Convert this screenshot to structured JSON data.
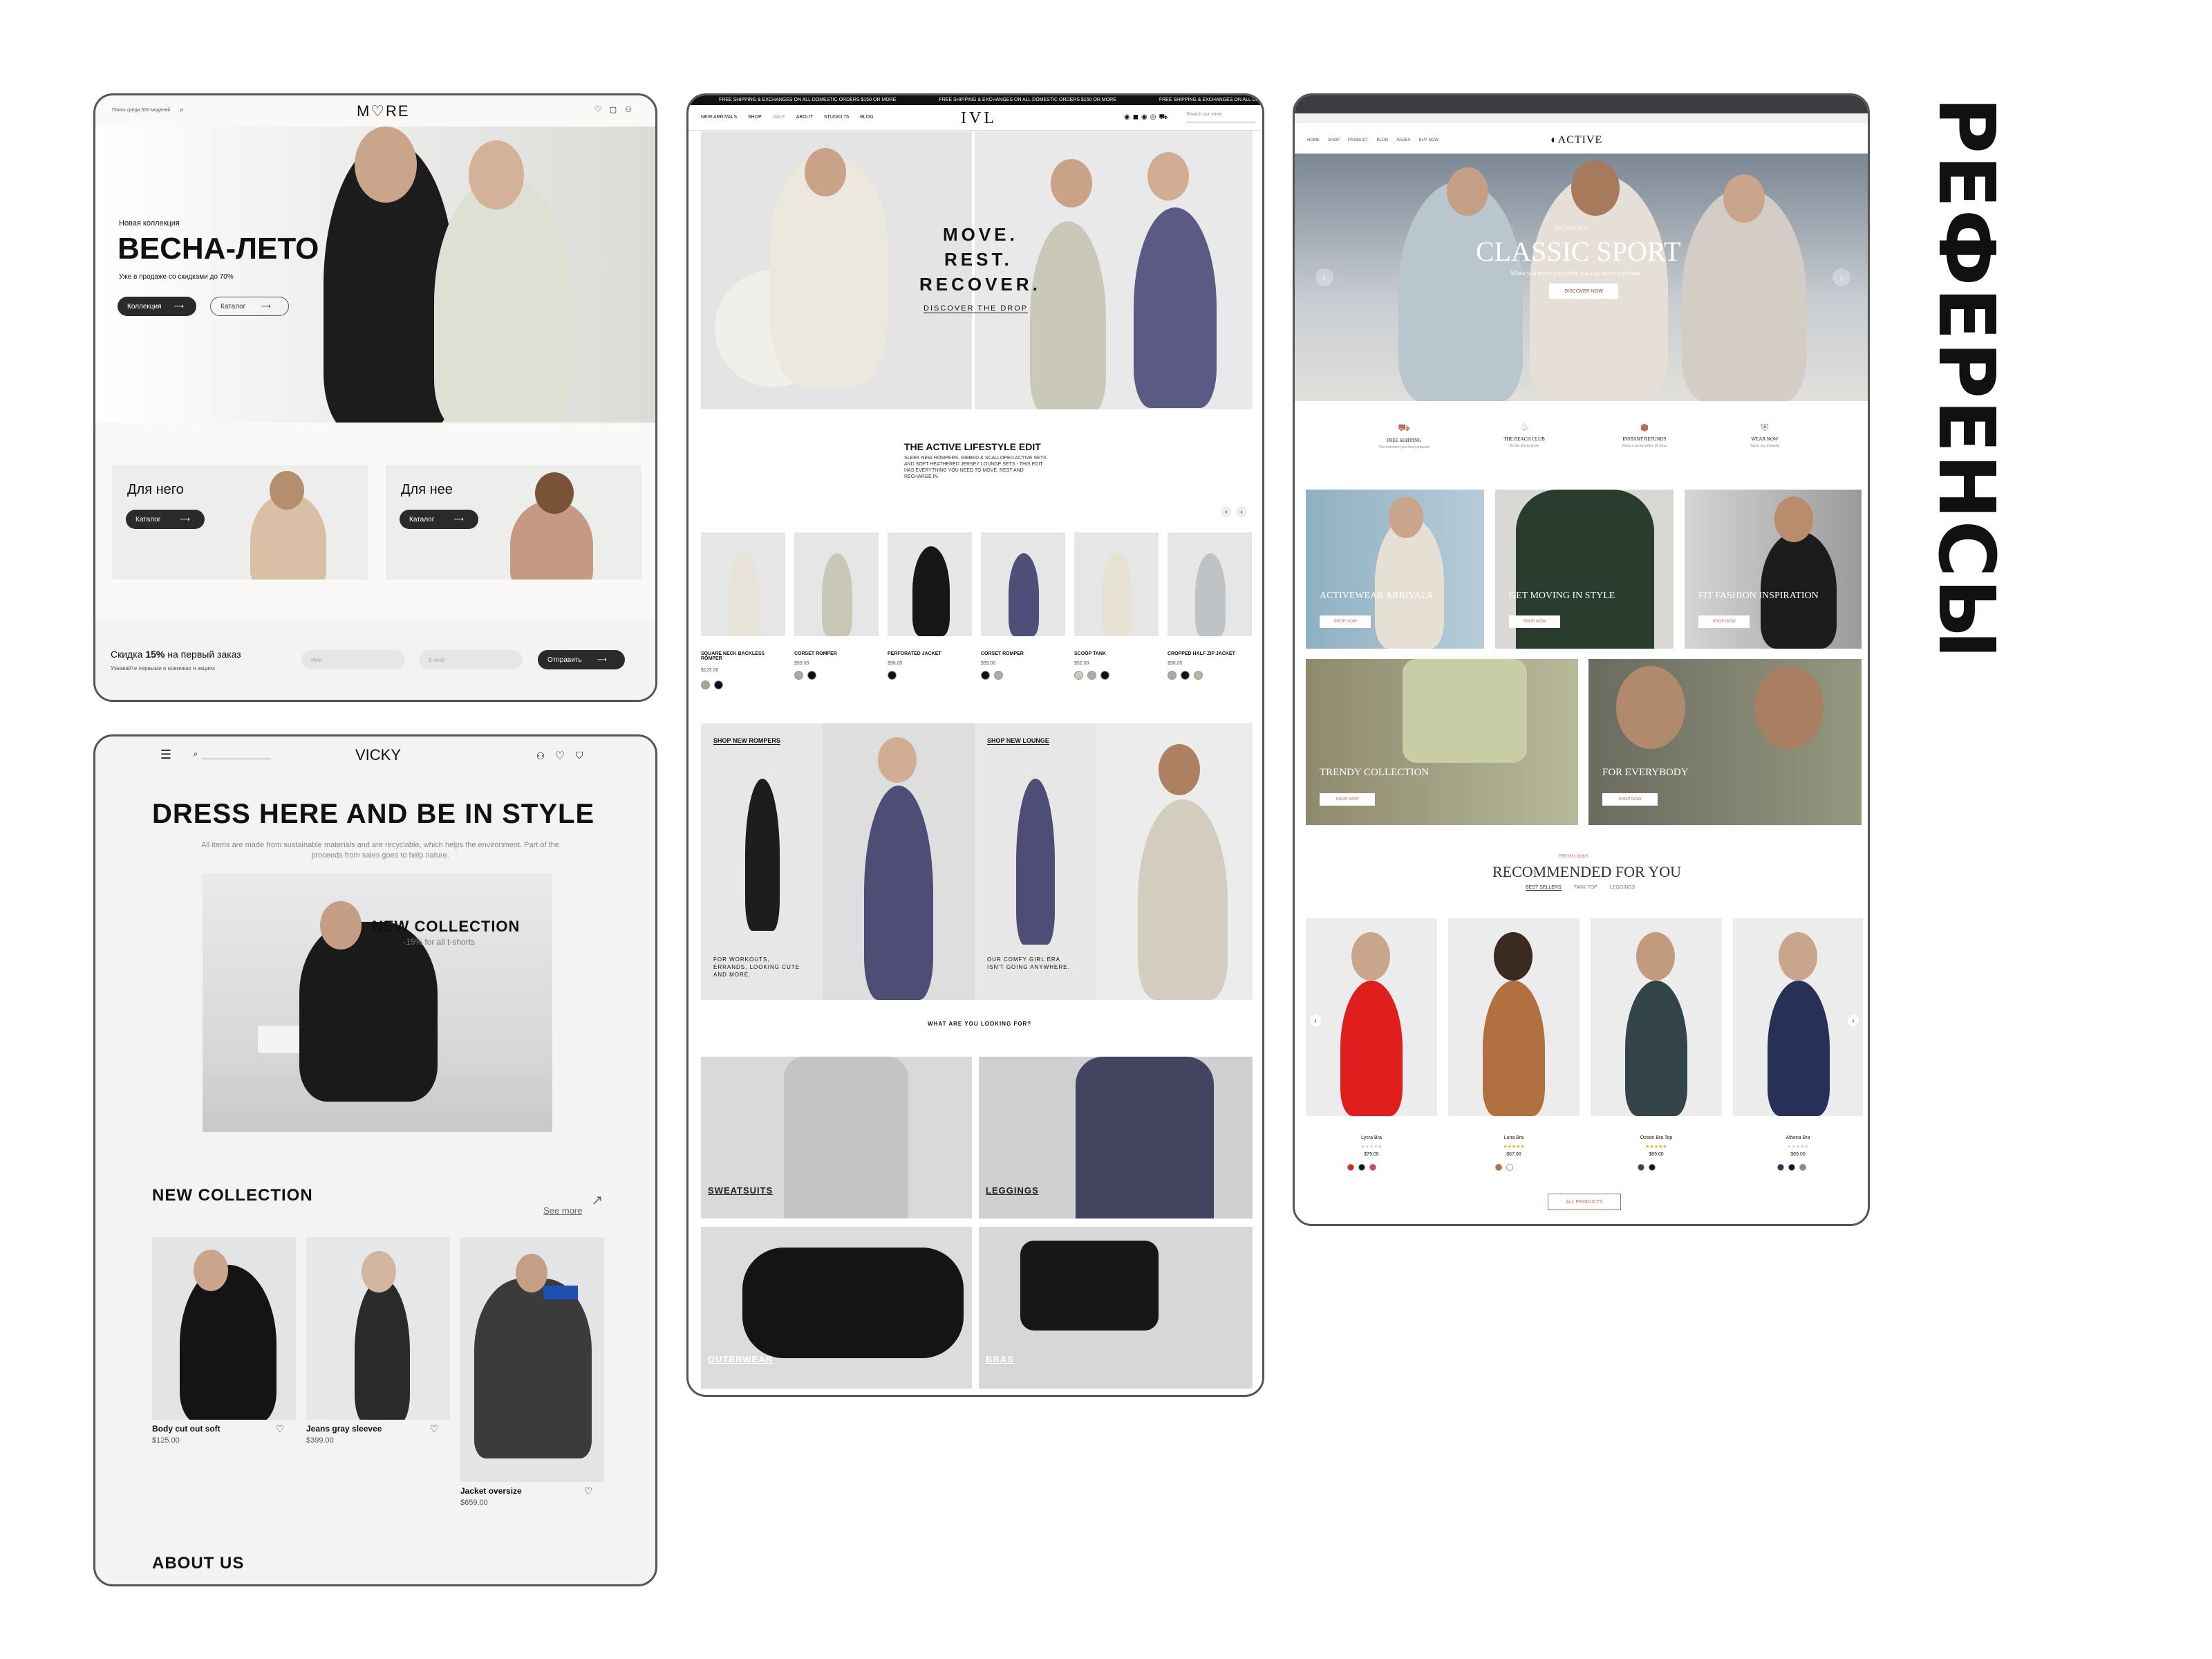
{
  "title_vertical": "РЕФЕРЕНСЫ",
  "more": {
    "search_hint": "Поиск среди 500 моделей",
    "logo": "M♡RE",
    "hero_kicker": "Новая коллекция",
    "hero_title": "ВЕСНА-ЛЕТО",
    "hero_sub": "Уже в продаже со скидками до 70%",
    "btn_collection": "Коллекция",
    "btn_catalog": "Каталог",
    "for_him": "Для него",
    "for_her": "Для нее",
    "catalog": "Каталог",
    "discount_prefix": "Скидка ",
    "discount_value": "15%",
    "discount_suffix": " на первый заказ",
    "discount_sub": "Узнавайте первыми о новинках и акциях",
    "name_placeholder": "Имя",
    "email_placeholder": "E-mail",
    "submit": "Отправить"
  },
  "vicky": {
    "logo": "VICKY",
    "headline": "DRESS HERE AND BE IN STYLE",
    "subtext": "All items are made from sustainable materials and are recyclable, which helps the environment. Part of the proceeds from sales goes to help nature.",
    "banner_title": "NEW COLLECTION",
    "banner_sub": "-15% for all t-shorts",
    "section_title": "NEW COLLECTION",
    "see_more": "See more",
    "products": [
      {
        "name": "Body cut out soft",
        "price": "$125.00"
      },
      {
        "name": "Jeans gray sleevee",
        "price": "$399.00"
      },
      {
        "name": "Jacket oversize",
        "price": "$659.00"
      }
    ],
    "about": "ABOUT US"
  },
  "ivl": {
    "banner": "FREE SHIPPING & EXCHANGES ON ALL DOMESTIC ORDERS $150 OR MORE",
    "nav": [
      "NEW ARRIVALS",
      "SHOP",
      "SALE",
      "ABOUT",
      "STUDIO 75",
      "BLOG"
    ],
    "logo": "IVL",
    "search_placeholder": "Search our store",
    "hero_line1": "MOVE.",
    "hero_line2": "REST.",
    "hero_line3": "RECOVER.",
    "hero_cta": "DISCOVER THE DROP",
    "edit_title": "THE ACTIVE LIFESTYLE EDIT",
    "edit_text": "SLEEK NEW ROMPERS, RIBBED & SCALLOPED ACTIVE SETS AND SOFT HEATHERED JERSEY LOUNGE SETS - THIS EDIT HAS EVERYTHING YOU NEED TO MOVE, REST AND RECHARGE IN.",
    "products": [
      {
        "name": "SQUARE NECK BACKLESS ROMPER",
        "price": "$123.00"
      },
      {
        "name": "CORSET ROMPER",
        "price": "$99.00"
      },
      {
        "name": "PERFORATED JACKET",
        "price": "$98.00"
      },
      {
        "name": "CORSET ROMPER",
        "price": "$99.00"
      },
      {
        "name": "SCOOP TANK",
        "price": "$52.00"
      },
      {
        "name": "CROPPED HALF ZIP JACKET",
        "price": "$98.00"
      }
    ],
    "shop_rompers": "SHOP NEW ROMPERS",
    "rompers_text": "FOR WORKOUTS, ERRANDS, LOOKING CUTE AND MORE.",
    "shop_lounge": "SHOP NEW LOUNGE",
    "lounge_text": "OUR COMFY GIRL ERA ISN'T GOING ANYWHERE.",
    "looking_for": "WHAT ARE YOU LOOKING FOR?",
    "categories": [
      "SWEATSUITS",
      "LEGGINGS",
      "OUTERWEAR",
      "BRAS"
    ]
  },
  "active": {
    "logo": "ACTIVE",
    "hero_kicker": "ALL NEW SS24",
    "hero_title": "CLASSIC SPORT",
    "hero_sub": "When you move your body you can move anywhere",
    "hero_cta": "DISCOVER NOW",
    "features": [
      {
        "title": "FREE SHIPPING",
        "sub": "The minimum (and less) required"
      },
      {
        "title": "THE BEACH CLUB",
        "sub": "Be the first to know"
      },
      {
        "title": "INSTANT REFUNDS",
        "sub": "Return money within 30 days"
      },
      {
        "title": "WEAR NOW",
        "sub": "Tap to buy instantly"
      }
    ],
    "tiles": [
      "ACTIVEWEAR ARRIVALS",
      "GET MOVING IN STYLE",
      "FIT FASHION INSPIRATION"
    ],
    "shop_now": "SHOP NOW",
    "tiles2": [
      "TRENDY COLLECTION",
      "FOR EVERYBODY"
    ],
    "rec_kicker": "FRESH LOOKS",
    "rec_title": "RECOMMENDED FOR YOU",
    "rec_tabs": [
      "BEST SELLERS",
      "TANK TOP",
      "LEGGINGS"
    ],
    "products": [
      {
        "name": "Lycra Bra",
        "price": "$79.00"
      },
      {
        "name": "Luna Bra",
        "price": "$67.00"
      },
      {
        "name": "Ocean Bra Top",
        "price": "$89.00"
      },
      {
        "name": "Athena Bra",
        "price": "$69.00"
      }
    ],
    "all_products": "ALL PRODUCTS"
  }
}
